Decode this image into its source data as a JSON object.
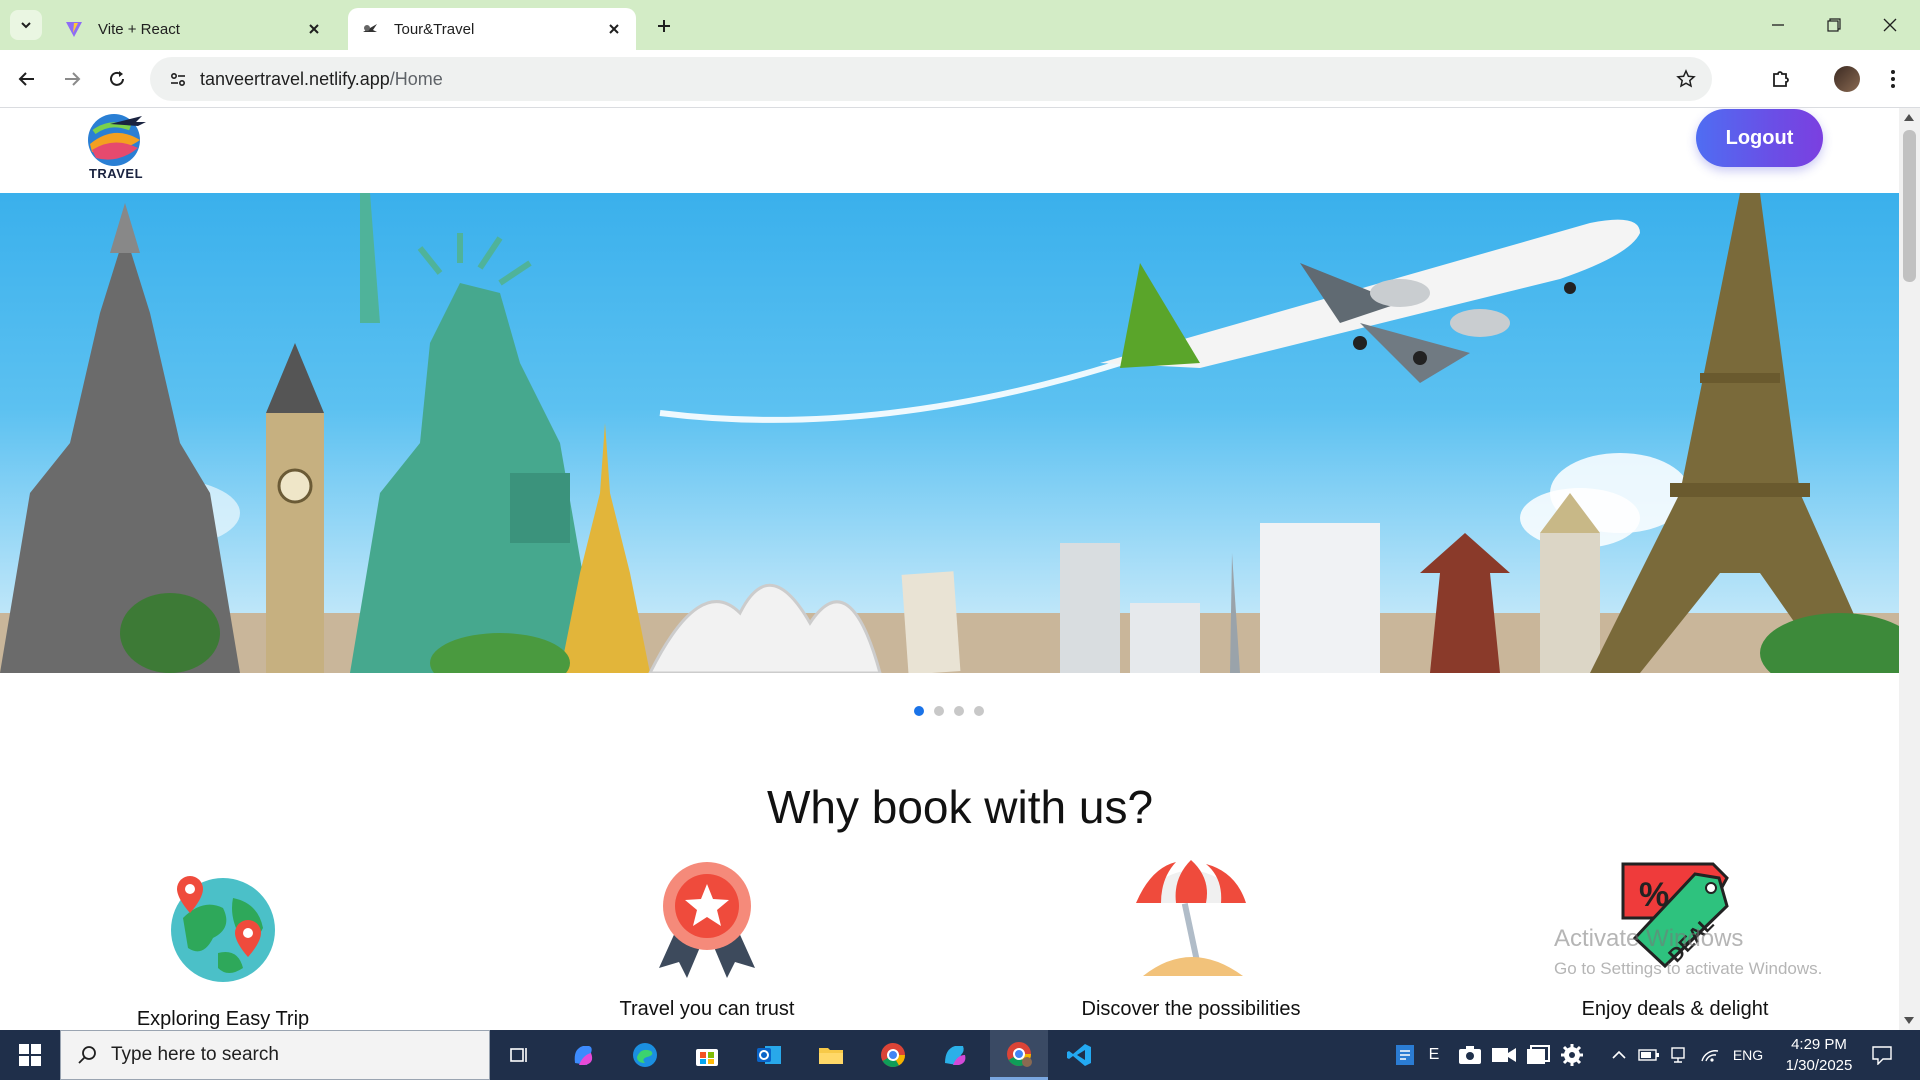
{
  "browser": {
    "tabs": [
      {
        "title": "Vite + React",
        "active": false,
        "favicon": "vite-logo-icon"
      },
      {
        "title": "Tour&Travel",
        "active": true,
        "favicon": "travel-favicon-icon"
      }
    ],
    "url_domain": "tanveertravel.netlify.app",
    "url_path": "/Home"
  },
  "site": {
    "logo_text": "TRAVEL",
    "logout_label": "Logout",
    "carousel": {
      "slide_count": 4,
      "active_index": 0
    },
    "section_title": "Why book with us?",
    "features": [
      {
        "label": "Exploring Easy Trip",
        "icon": "globe-pins-icon"
      },
      {
        "label": "Travel you can trust",
        "icon": "award-ribbon-icon"
      },
      {
        "label": "Discover the possibilities",
        "icon": "beach-umbrella-icon"
      },
      {
        "label": "Enjoy deals & delight",
        "icon": "deal-tag-icon"
      }
    ]
  },
  "watermark": {
    "line1": "Activate Windows",
    "line2": "Go to Settings to activate Windows."
  },
  "taskbar": {
    "search_placeholder": "Type here to search",
    "language": "ENG",
    "time": "4:29 PM",
    "date": "1/30/2025"
  },
  "colors": {
    "tabbar_bg": "#d3ecc6",
    "logout_gradient_start": "#4f6df2",
    "logout_gradient_end": "#7b3fe0",
    "carousel_active_dot": "#1a73e8",
    "taskbar_bg": "#1f2f4a"
  }
}
